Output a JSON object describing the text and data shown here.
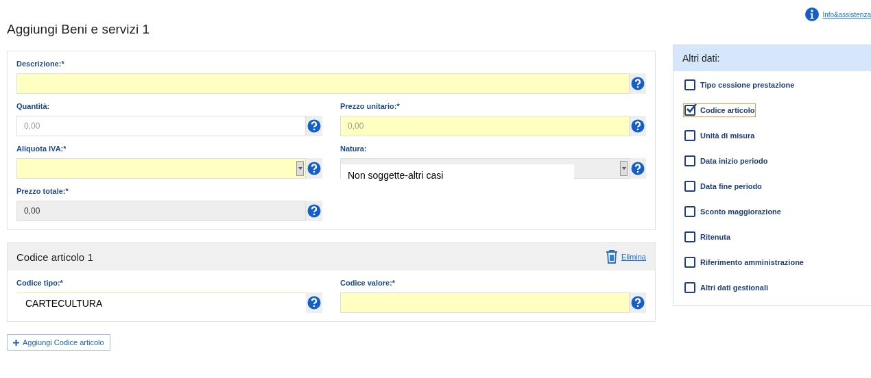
{
  "help_link": {
    "label": "Info&assistenza"
  },
  "title": "Aggiungi Beni e servizi 1",
  "main_rows": [
    [
      {
        "label": "Descrizione:*",
        "kind": "text",
        "required": true,
        "disabled": false
      }
    ],
    [
      {
        "label": "Quantità:",
        "kind": "text",
        "required": false,
        "disabled": false,
        "placeholder": "0,00"
      },
      {
        "label": "Prezzo unitario:*",
        "kind": "text",
        "required": true,
        "disabled": false,
        "placeholder": "0,00"
      }
    ],
    [
      {
        "label": "Aliquota IVA:*",
        "kind": "select",
        "required": true,
        "disabled": false
      },
      {
        "label": "Natura:",
        "kind": "select",
        "disabled": true,
        "value": "Non soggette-altri casi"
      }
    ],
    [
      {
        "label": "Prezzo totale:*",
        "kind": "text",
        "disabled": true,
        "value": "0,00"
      }
    ]
  ],
  "codice_articolo": {
    "title": "Codice articolo 1",
    "delete_link": "Elimina",
    "rows": [
      [
        {
          "label": "Codice tipo:*",
          "kind": "text",
          "required": false,
          "disabled": false,
          "value": "CARTECULTURA"
        },
        {
          "label": "Codice valore:*",
          "kind": "text",
          "required": true,
          "disabled": false
        }
      ]
    ]
  },
  "add_button": "Aggiungi Codice articolo",
  "altri_dati": {
    "title": "Altri dati:",
    "items": [
      {
        "label": "Tipo cessione prestazione",
        "checked": false,
        "selected": false
      },
      {
        "label": "Codice articolo",
        "checked": true,
        "selected": true
      },
      {
        "label": "Unità di misura",
        "checked": false,
        "selected": false
      },
      {
        "label": "Data inizio periodo",
        "checked": false,
        "selected": false
      },
      {
        "label": "Data fine periodo",
        "checked": false,
        "selected": false
      },
      {
        "label": "Sconto maggiorazione",
        "checked": false,
        "selected": false
      },
      {
        "label": "Ritenuta",
        "checked": false,
        "selected": false
      },
      {
        "label": "Riferimento amministrazione",
        "checked": false,
        "selected": false
      },
      {
        "label": "Altri dati gestionali",
        "checked": false,
        "selected": false
      }
    ]
  }
}
